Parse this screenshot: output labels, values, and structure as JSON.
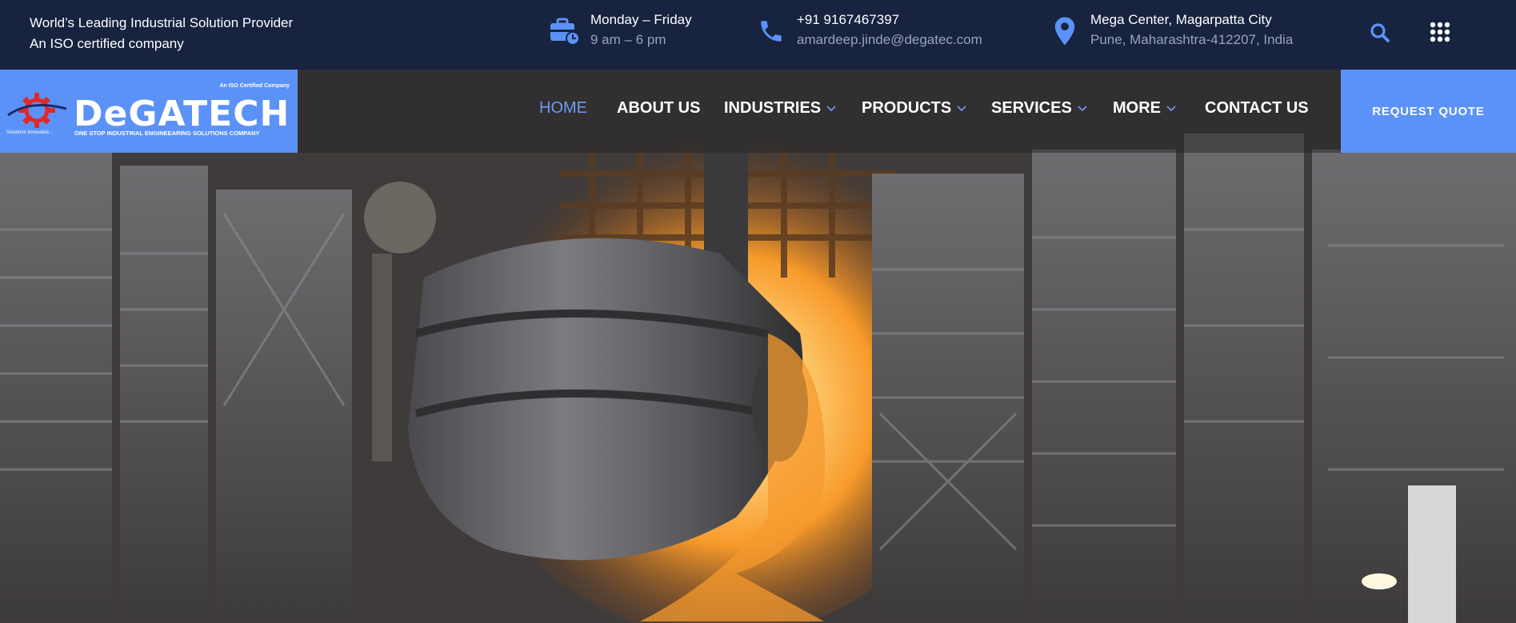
{
  "topbar": {
    "line1": "World’s Leading Industrial Solution Provider",
    "line2": "An ISO certified company",
    "hours": {
      "icon": "briefcase-clock-icon",
      "title": "Monday – Friday",
      "detail": "9 am – 6 pm"
    },
    "contact": {
      "icon": "phone-icon",
      "title": "+91 9167467397",
      "detail": "amardeep.jinde@degatec.com"
    },
    "location": {
      "icon": "map-pin-icon",
      "title": "Mega Center, Magarpatta City",
      "detail": "Pune, Maharashtra-412207, India"
    },
    "search_icon": "search-icon",
    "menu_icon": "grid-menu-icon"
  },
  "logo": {
    "brand": "DeGATECH",
    "iso_note": "An ISO Certified Company",
    "subline": "ONE STOP INDUSTRIAL ENGINEEARING SOLUTIONS COMPANY",
    "tagline": "Solutions Innovated..."
  },
  "nav": {
    "items": [
      {
        "label": "HOME",
        "active": true
      },
      {
        "label": "ABOUT US"
      },
      {
        "label": "INDUSTRIES",
        "dropdown": true
      },
      {
        "label": "PRODUCTS",
        "dropdown": true
      },
      {
        "label": "SERVICES",
        "dropdown": true
      },
      {
        "label": "MORE",
        "dropdown": true
      },
      {
        "label": "CONTACT US"
      }
    ],
    "cta": "REQUEST QUOTE"
  },
  "colors": {
    "topbar_bg": "#17233f",
    "accent": "#5b92f7",
    "active_nav": "#6b9cf8"
  }
}
